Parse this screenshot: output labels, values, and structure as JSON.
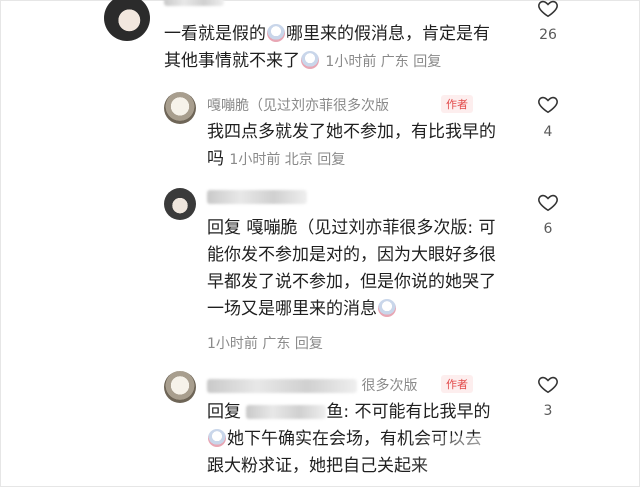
{
  "comments": [
    {
      "line1": "一看就是假的",
      "line1b": "哪里来的假消息，肯定是有",
      "line2": "其他事情就不来了",
      "time": "1小时前",
      "loc": "广东",
      "reply": "回复",
      "likes": "26"
    },
    {
      "name": "嘎嘣脆（见过刘亦菲很多次版",
      "badge": "作者",
      "line1": "我四点多就发了她不参加，有比我早的",
      "line2": "吗",
      "time": "1小时前",
      "loc": "北京",
      "reply": "回复",
      "likes": "4"
    },
    {
      "line1": "回复 嘎嘣脆（见过刘亦菲很多次版: 可",
      "line2": "能你发不参加是对的，因为大眼好多很",
      "line3": "早都发了说不参加，但是你说的她哭了",
      "line4": "一场又是哪里来的消息",
      "time": "1小时前",
      "loc": "广东",
      "reply": "回复",
      "likes": "6"
    },
    {
      "name": "很多次版",
      "badge": "作者",
      "line1a": "回复",
      "line1b": "鱼: 不可能有比我早的",
      "line2": "她下午确实在会场，有机会可以去",
      "line3": "跟大粉求证，她把自己关起来",
      "likes": "3"
    }
  ],
  "icons": {
    "like": "heart-outline-icon",
    "emoji": "crying-face-emoji-icon"
  }
}
